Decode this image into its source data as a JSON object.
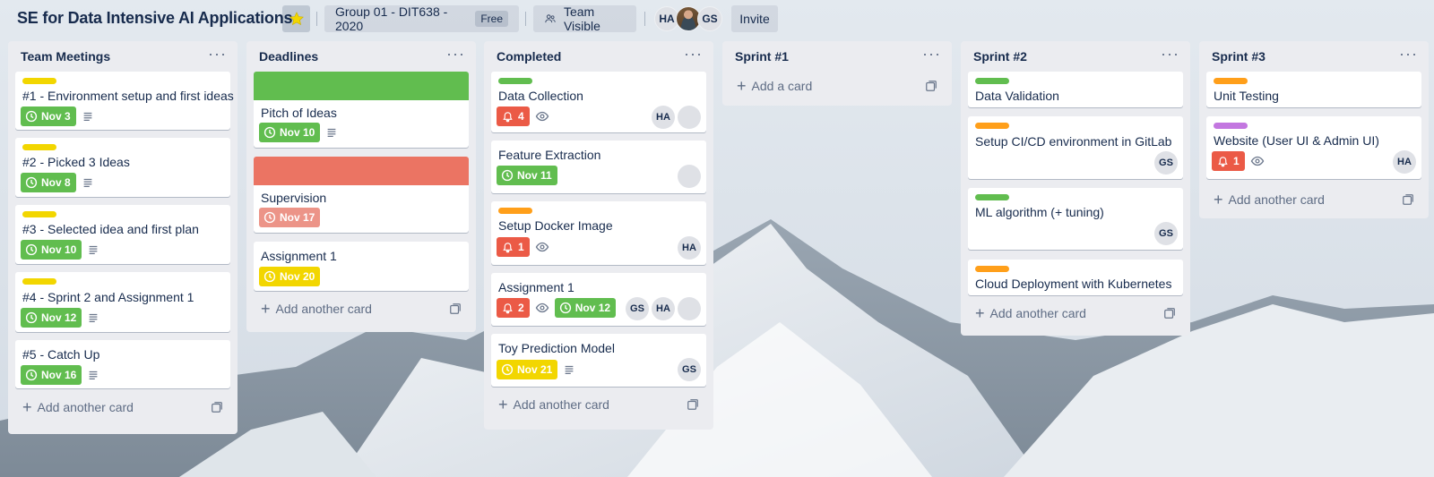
{
  "header": {
    "board_title": "SE for Data Intensive AI Applications",
    "workspace": "Group 01 - DIT638 - 2020",
    "plan_badge": "Free",
    "visibility": "Team Visible",
    "members": [
      "HA",
      "GS"
    ],
    "invite_label": "Invite"
  },
  "colors": {
    "green": "#61bd4f",
    "yellow": "#f2d600",
    "orange": "#ff9f1a",
    "red": "#eb5a46",
    "purple": "#c377e0"
  },
  "lists": {
    "team_meetings": {
      "title": "Team Meetings",
      "cards": [
        {
          "title": "#1 - Environment setup and first ideas",
          "due": "Nov 3"
        },
        {
          "title": "#2 - Picked 3 Ideas",
          "due": "Nov 8"
        },
        {
          "title": "#3 - Selected idea and first plan",
          "due": "Nov 10"
        },
        {
          "title": "#4 - Sprint 2 and Assignment 1",
          "due": "Nov 12"
        },
        {
          "title": "#5 - Catch Up",
          "due": "Nov 16"
        }
      ],
      "add_label": "Add another card"
    },
    "deadlines": {
      "title": "Deadlines",
      "cards": [
        {
          "title": "Pitch of Ideas",
          "due": "Nov 10"
        },
        {
          "title": "Supervision",
          "due": "Nov 17"
        },
        {
          "title": "Assignment 1",
          "due": "Nov 20"
        }
      ],
      "add_label": "Add another card"
    },
    "completed": {
      "title": "Completed",
      "cards": [
        {
          "title": "Data Collection",
          "notifications": "4"
        },
        {
          "title": "Feature Extraction",
          "due": "Nov 11"
        },
        {
          "title": "Setup Docker Image",
          "notifications": "1"
        },
        {
          "title": "Assignment 1",
          "notifications": "2",
          "due": "Nov 12"
        },
        {
          "title": "Toy Prediction Model",
          "due": "Nov 21"
        }
      ],
      "add_label": "Add another card"
    },
    "sprint1": {
      "title": "Sprint #1",
      "add_label": "Add a card"
    },
    "sprint2": {
      "title": "Sprint #2",
      "cards": [
        {
          "title": "Data Validation"
        },
        {
          "title": "Setup CI/CD environment in GitLab"
        },
        {
          "title": "ML algorithm (+ tuning)"
        },
        {
          "title": "Cloud Deployment with Kubernetes"
        }
      ],
      "add_label": "Add another card"
    },
    "sprint3": {
      "title": "Sprint #3",
      "cards": [
        {
          "title": "Unit Testing"
        },
        {
          "title": "Website (User UI & Admin UI)",
          "notifications": "1"
        }
      ],
      "add_label": "Add another card"
    }
  }
}
